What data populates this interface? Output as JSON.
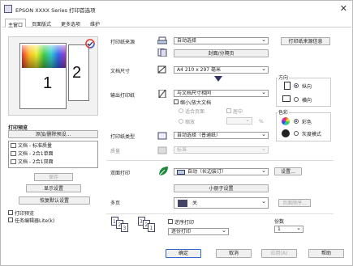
{
  "window": {
    "title": "EPSON XXXX Series 打印首选项",
    "close_glyph": "✕"
  },
  "tabs": [
    "主窗口",
    "页面版式",
    "更多选项",
    "维护"
  ],
  "preview": {
    "front_number": "1",
    "back_number": "2",
    "title": "打印预览"
  },
  "left": {
    "add_remove_button": "添加/删除预设...",
    "presets": [
      "文档 - 标准质量",
      "文档 - 2合1单面",
      "文档 - 2合1双面"
    ],
    "save_button": "保存",
    "show_settings_button": "显示设置",
    "restore_defaults_button": "恢复默认设置",
    "print_preview_check": "打印预览",
    "job_arranger_check": "任务编辑器Lite(k)"
  },
  "paper_source": {
    "label": "打印纸来源",
    "value": "自动选择",
    "button": "打印纸来源信息"
  },
  "cover_button": "封面/分隔页",
  "doc_size": {
    "label": "文档尺寸",
    "value": "A4 210 x 297 毫米"
  },
  "output_paper": {
    "label": "输出打印纸",
    "value": "与文档尺寸相同",
    "reduce_check": "缩小/放大文档",
    "fit_page": "适合页面",
    "zoom": "缩放",
    "center": "居中",
    "percent_unit": "%"
  },
  "orientation": {
    "label": "方向",
    "portrait": "纵向",
    "landscape": "横向"
  },
  "paper_type": {
    "label": "打印纸类型",
    "value": "自动选择（普通纸）"
  },
  "quality": {
    "label": "质量",
    "value": "标准"
  },
  "color": {
    "label": "色彩",
    "color": "彩色",
    "grayscale": "灰度模式"
  },
  "duplex": {
    "label": "双面打印",
    "value": "自动（长边装订）",
    "settings_button": "设置...",
    "booklet_button": "小册子设置"
  },
  "multipage": {
    "label": "多页",
    "value": "关",
    "order_button": "页面顺序..."
  },
  "copies": {
    "reverse_check": "逆序打印",
    "collate_value": "逐份打印",
    "count_label": "份数",
    "count": "1"
  },
  "bottom": {
    "ok": "确定",
    "cancel": "取消",
    "apply": "应用(A)",
    "help": "帮助"
  }
}
